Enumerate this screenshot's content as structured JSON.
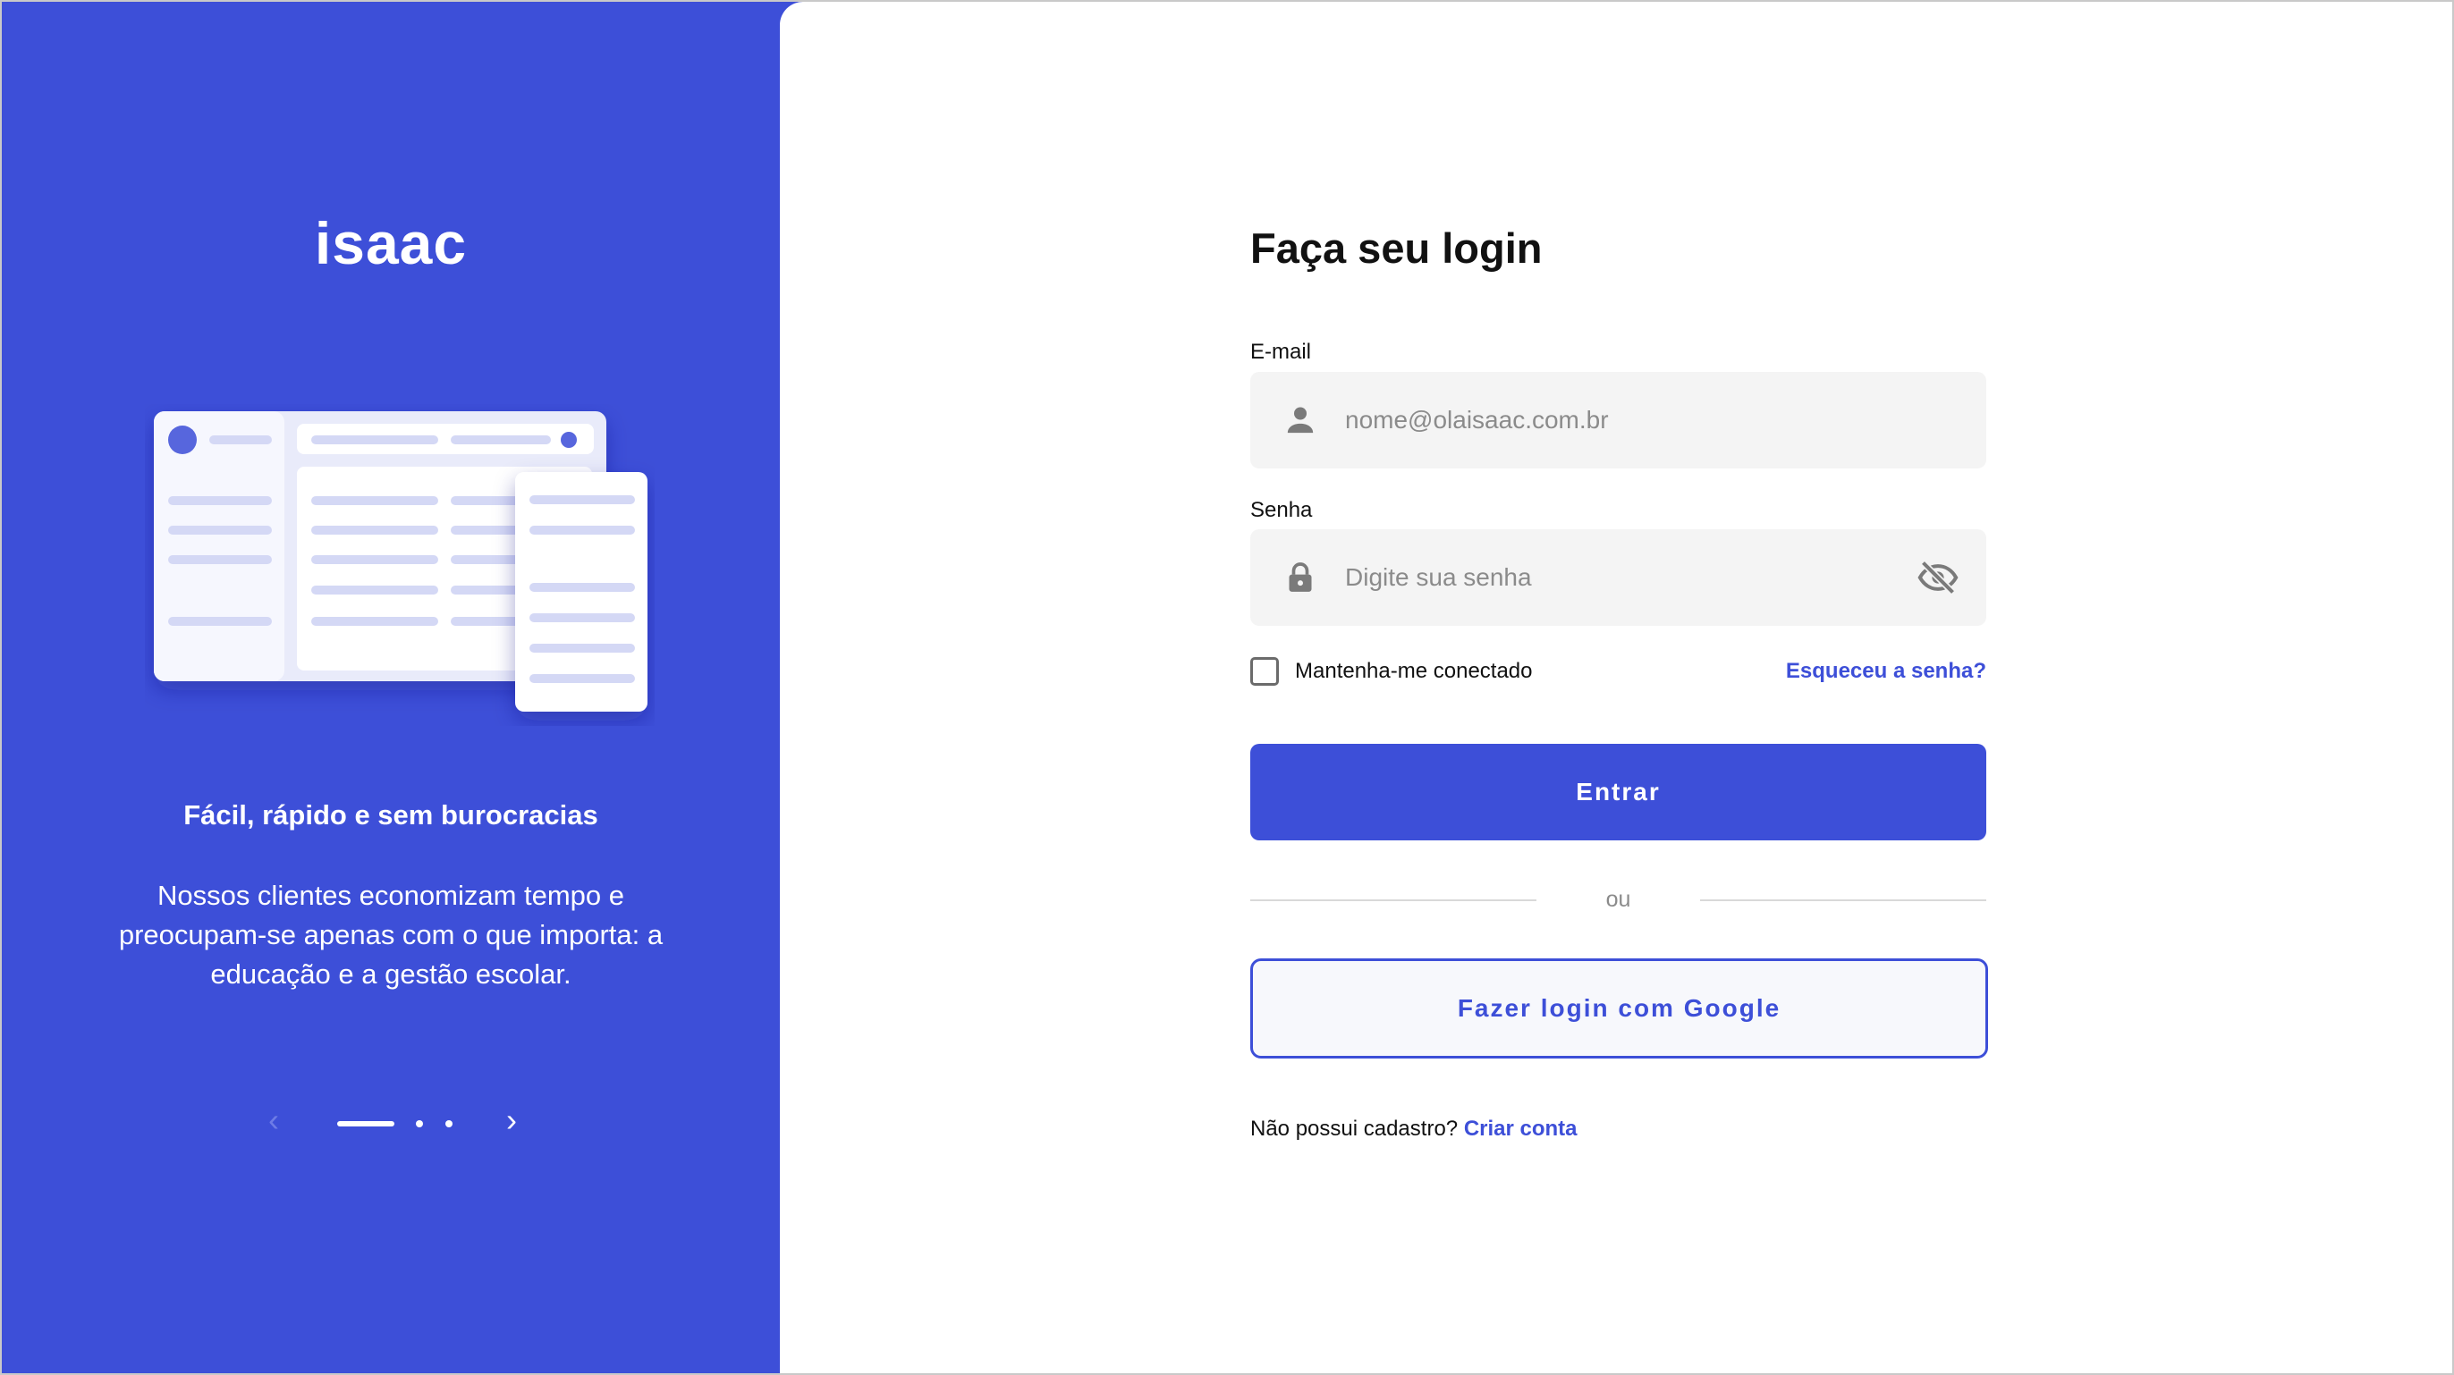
{
  "left_panel": {
    "logo": "isaac",
    "tagline": "Fácil, rápido e sem burocracias",
    "description": "Nossos clientes economizam tempo e preocupam-se apenas com o que importa: a educação e a gestão escolar.",
    "carousel": {
      "prev_icon": "chevron-left-icon",
      "next_icon": "chevron-right-icon",
      "slides": 3,
      "active_index": 0
    }
  },
  "login": {
    "title": "Faça seu login",
    "email": {
      "label": "E-mail",
      "placeholder": "nome@olaisaac.com.br",
      "value": "",
      "icon": "user-icon"
    },
    "password": {
      "label": "Senha",
      "placeholder": "Digite sua senha",
      "value": "",
      "icon": "lock-icon",
      "toggle_icon": "eye-off-icon"
    },
    "remember_label": "Mantenha-me conectado",
    "remember_checked": false,
    "forgot_label": "Esqueceu a senha?",
    "submit_label": "Entrar",
    "divider_label": "ou",
    "google_label": "Fazer login com Google",
    "signup_text": "Não possui cadastro?",
    "signup_link": "Criar conta"
  },
  "colors": {
    "brand": "#3d4fd8",
    "field_bg": "#f4f4f4",
    "placeholder": "#8b8b8b",
    "illustration_bar": "#d4d8f5"
  }
}
